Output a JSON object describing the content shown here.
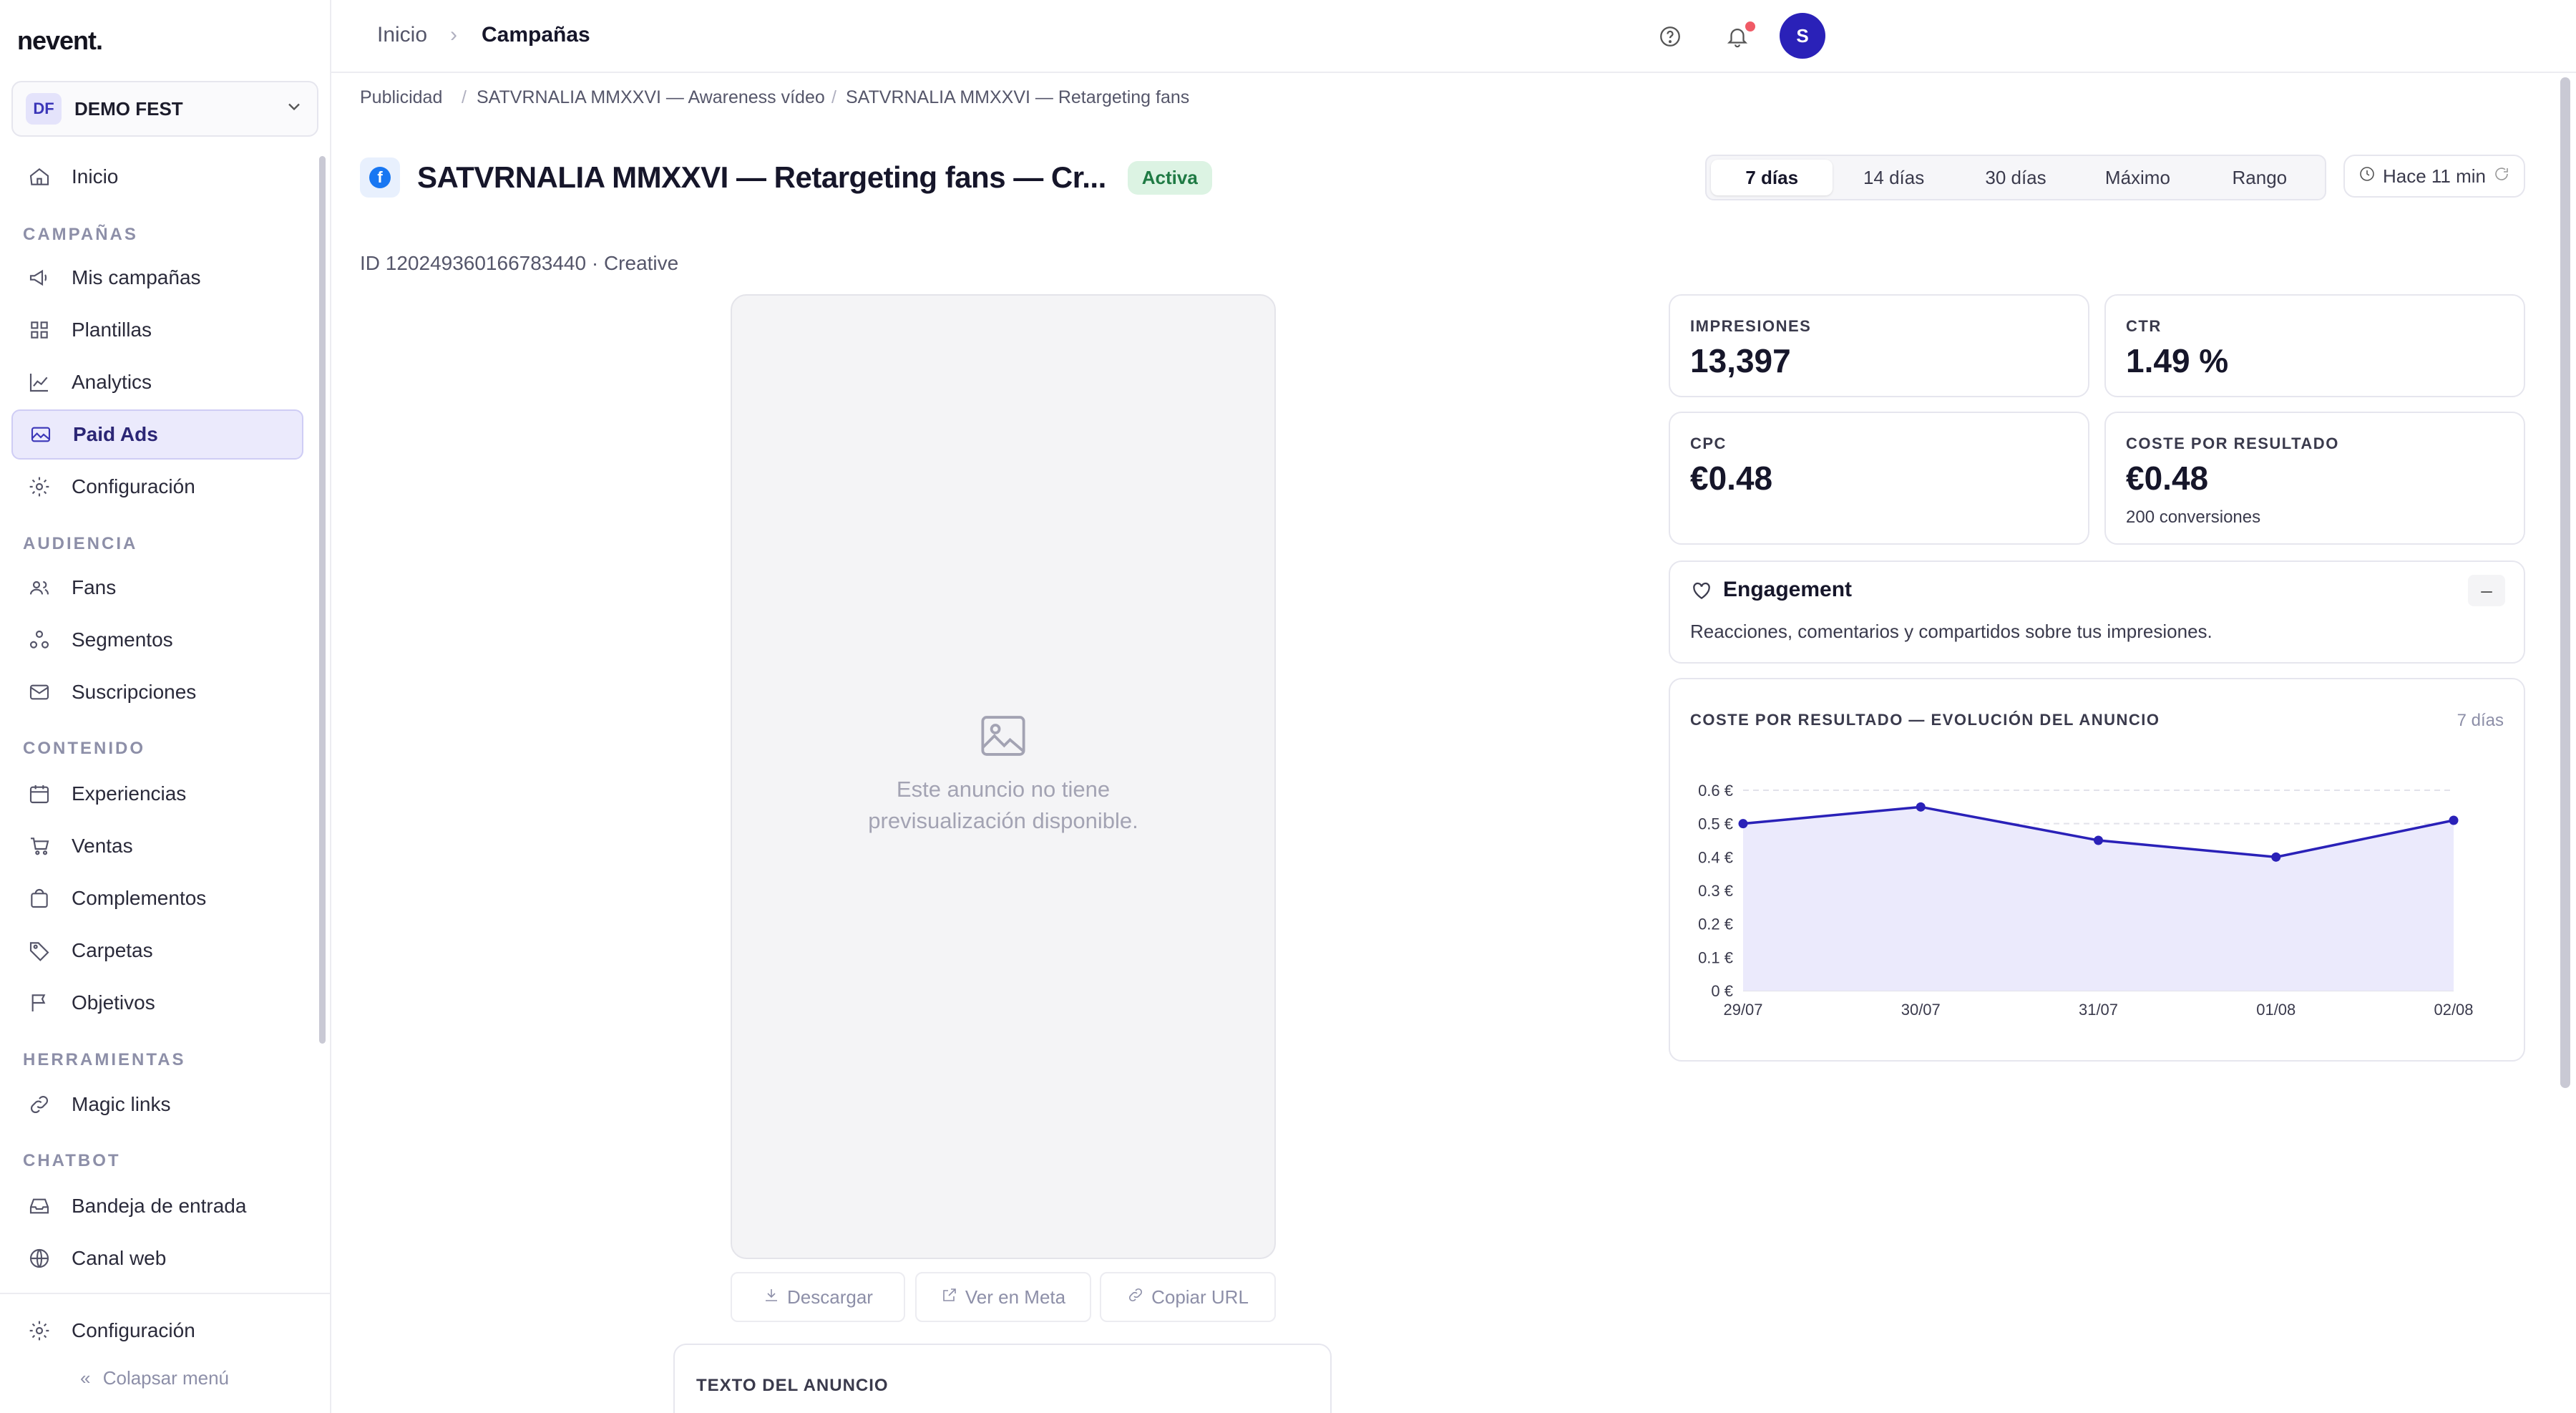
{
  "sidebar": {
    "logo": "nevent.",
    "org": {
      "badge": "DF",
      "name": "DEMO FEST"
    },
    "home": "Inicio",
    "sections": {
      "campaigns": "CAMPAÑAS",
      "audience": "AUDIENCIA",
      "content": "CONTENIDO",
      "tools": "HERRAMIENTAS",
      "chatbot": "CHATBOT"
    },
    "items": {
      "my_campaigns": "Mis campañas",
      "templates": "Plantillas",
      "analytics": "Analytics",
      "paid_ads": "Paid Ads",
      "campaign_config": "Configuración",
      "fans": "Fans",
      "segments": "Segmentos",
      "subscriptions": "Suscripciones",
      "experiences": "Experiencias",
      "sales": "Ventas",
      "addons": "Complementos",
      "folders": "Carpetas",
      "goals": "Objetivos",
      "magic_links": "Magic links",
      "inbox": "Bandeja de entrada",
      "web_channel": "Canal web",
      "settings": "Configuración"
    },
    "collapse": "Colapsar menú"
  },
  "topbar": {
    "crumb_home": "Inicio",
    "crumb_sep": "›",
    "crumb_current": "Campañas",
    "avatar": "S"
  },
  "breadcrumb": {
    "level1": "Publicidad",
    "level2": "SATVRNALIA MMXXVI — Awareness vídeo",
    "level3": "SATVRNALIA MMXXVI — Retargeting fans",
    "sep": "/"
  },
  "ad": {
    "platform_glyph": "f",
    "title": "SATVRNALIA MMXXVI — Retargeting fans — Cr...",
    "status": "Activa",
    "id_line": "ID 120249360166783440 · Creative",
    "preview_message_line1": "Este anuncio no tiene",
    "preview_message_line2": "previsualización disponible.",
    "download": "Descargar",
    "view_meta": "Ver en Meta",
    "copy_url": "Copiar URL",
    "ad_text_heading": "TEXTO DEL ANUNCIO"
  },
  "range": {
    "tabs": [
      "7 días",
      "14 días",
      "30 días",
      "Máximo",
      "Rango"
    ],
    "selected_index": 0,
    "refresh_label": "Hace 11 min"
  },
  "metrics": {
    "impressions": {
      "label": "IMPRESIONES",
      "value": "13,397"
    },
    "ctr": {
      "label": "CTR",
      "value": "1.49 %"
    },
    "cpc": {
      "label": "CPC",
      "value": "€0.48"
    },
    "cpr": {
      "label": "COSTE POR RESULTADO",
      "value": "€0.48",
      "sub": "200 conversiones"
    }
  },
  "engagement": {
    "title": "Engagement",
    "toggle": "–",
    "description": "Reacciones, comentarios y compartidos sobre tus impresiones."
  },
  "chart_card": {
    "title": "COSTE POR RESULTADO — EVOLUCIÓN DEL ANUNCIO",
    "range_label": "7 días"
  },
  "chart_data": {
    "type": "area",
    "title": "COSTE POR RESULTADO — EVOLUCIÓN DEL ANUNCIO",
    "xlabel": "",
    "ylabel": "",
    "categories": [
      "29/07",
      "30/07",
      "31/07",
      "01/08",
      "02/08"
    ],
    "series": [
      {
        "values": [
          0.5,
          0.55,
          0.45,
          0.4,
          0.51
        ]
      }
    ],
    "ylim": [
      0,
      0.6
    ],
    "yticks": [
      0,
      0.1,
      0.2,
      0.3,
      0.4,
      0.5,
      0.6
    ],
    "ytick_labels": [
      "0 €",
      "0.1 €",
      "0.2 €",
      "0.3 €",
      "0.4 €",
      "0.5 €",
      "0.6 €"
    ],
    "grid": true,
    "colors": {
      "line": "#2a21b8",
      "fill": "#ebeafc"
    }
  },
  "colors": {
    "accent": "#2a21b8",
    "status_active": "#1f7a44"
  }
}
